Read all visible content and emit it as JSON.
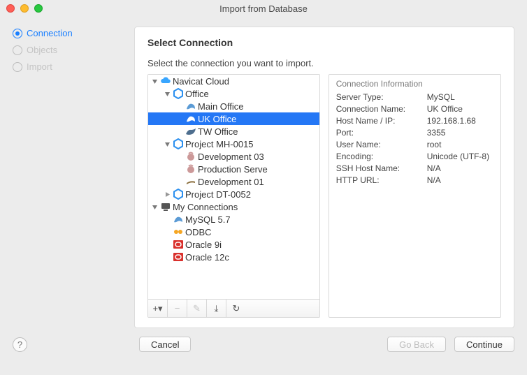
{
  "window": {
    "title": "Import from Database"
  },
  "steps": [
    {
      "label": "Connection",
      "active": true
    },
    {
      "label": "Objects",
      "active": false
    },
    {
      "label": "Import",
      "active": false
    }
  ],
  "panel": {
    "heading": "Select Connection",
    "subhead": "Select the connection you want to import."
  },
  "tree": [
    {
      "label": "Navicat Cloud",
      "depth": 0,
      "expanded": true,
      "icon": "cloud",
      "selected": false
    },
    {
      "label": "Office",
      "depth": 1,
      "expanded": true,
      "icon": "hexagon-blue",
      "selected": false
    },
    {
      "label": "Main Office",
      "depth": 2,
      "expanded": false,
      "icon": "mysql-dolphin",
      "selected": false
    },
    {
      "label": "UK Office",
      "depth": 2,
      "expanded": false,
      "icon": "mysql-dolphin-white",
      "selected": true
    },
    {
      "label": "TW Office",
      "depth": 2,
      "expanded": false,
      "icon": "mariadb",
      "selected": false
    },
    {
      "label": "Project MH-0015",
      "depth": 1,
      "expanded": true,
      "icon": "hexagon-blue",
      "selected": false
    },
    {
      "label": "Development 03",
      "depth": 2,
      "expanded": false,
      "icon": "postgres",
      "selected": false
    },
    {
      "label": "Production Serve",
      "depth": 2,
      "expanded": false,
      "icon": "postgres",
      "selected": false
    },
    {
      "label": "Development 01",
      "depth": 2,
      "expanded": false,
      "icon": "sqlite",
      "selected": false
    },
    {
      "label": "Project DT-0052",
      "depth": 1,
      "expanded": false,
      "icon": "hexagon-blue",
      "selected": false,
      "hasChildren": true
    },
    {
      "label": "My Connections",
      "depth": 0,
      "expanded": true,
      "icon": "computer",
      "selected": false
    },
    {
      "label": "MySQL 5.7",
      "depth": 1,
      "expanded": false,
      "icon": "mysql-dolphin",
      "selected": false
    },
    {
      "label": "ODBC",
      "depth": 1,
      "expanded": false,
      "icon": "odbc",
      "selected": false
    },
    {
      "label": "Oracle 9i",
      "depth": 1,
      "expanded": false,
      "icon": "oracle",
      "selected": false
    },
    {
      "label": "Oracle 12c",
      "depth": 1,
      "expanded": false,
      "icon": "oracle",
      "selected": false
    }
  ],
  "tree_toolbar": [
    {
      "name": "add",
      "glyph": "+▾",
      "enabled": true
    },
    {
      "name": "remove",
      "glyph": "−",
      "enabled": false
    },
    {
      "name": "edit",
      "glyph": "✎",
      "enabled": false
    },
    {
      "name": "import",
      "glyph": "⤓",
      "enabled": true
    },
    {
      "name": "reload",
      "glyph": "↻",
      "enabled": true
    }
  ],
  "info": {
    "title": "Connection Information",
    "rows": [
      {
        "label": "Server Type:",
        "value": "MySQL"
      },
      {
        "label": "Connection Name:",
        "value": "UK Office"
      },
      {
        "label": "Host Name / IP:",
        "value": "192.168.1.68"
      },
      {
        "label": "Port:",
        "value": "3355"
      },
      {
        "label": "User Name:",
        "value": "root"
      },
      {
        "label": "Encoding:",
        "value": "Unicode (UTF-8)"
      },
      {
        "label": "SSH Host Name:",
        "value": "N/A"
      },
      {
        "label": "HTTP URL:",
        "value": "N/A"
      }
    ]
  },
  "buttons": {
    "cancel": "Cancel",
    "go_back": "Go Back",
    "continue": "Continue"
  }
}
